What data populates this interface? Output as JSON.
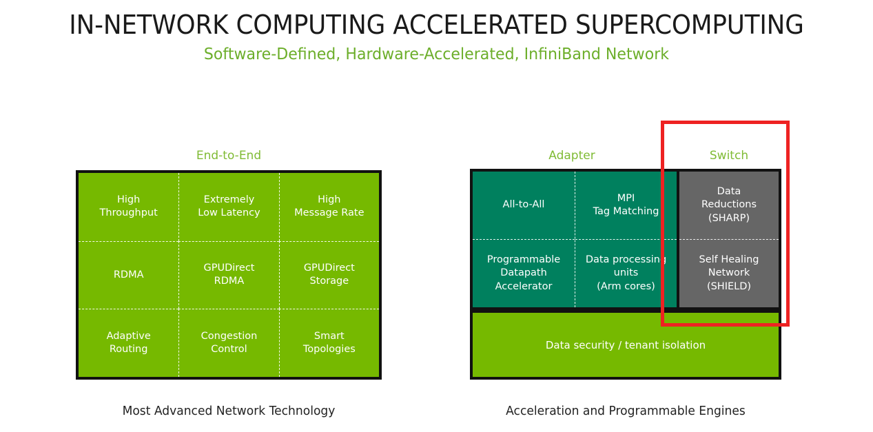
{
  "slide": {
    "title": "IN-NETWORK COMPUTING ACCELERATED SUPERCOMPUTING",
    "subtitle": "Software-Defined, Hardware-Accelerated, InfiniBand Network",
    "accent_green": "#76b900",
    "accent_teal": "#00805e",
    "accent_gray": "#666666",
    "subtitle_green": "#6cae2a",
    "label_green": "#7fbb34",
    "highlight_red": "#ee2222"
  },
  "left_panel": {
    "header": "End-to-End",
    "caption": "Most Advanced Network Technology",
    "grid": {
      "rows": [
        [
          "High\nThroughput",
          "Extremely\nLow Latency",
          "High\nMessage Rate"
        ],
        [
          "RDMA",
          "GPUDirect\nRDMA",
          "GPUDirect\nStorage"
        ],
        [
          "Adaptive\nRouting",
          "Congestion\nControl",
          "Smart\nTopologies"
        ]
      ],
      "cells": [
        {
          "line1": "High",
          "line2": "Throughput"
        },
        {
          "line1": "Extremely",
          "line2": "Low Latency"
        },
        {
          "line1": "High",
          "line2": "Message Rate"
        },
        {
          "line1": "RDMA",
          "line2": ""
        },
        {
          "line1": "GPUDirect",
          "line2": "RDMA"
        },
        {
          "line1": "GPUDirect",
          "line2": "Storage"
        },
        {
          "line1": "Adaptive",
          "line2": "Routing"
        },
        {
          "line1": "Congestion",
          "line2": "Control"
        },
        {
          "line1": "Smart",
          "line2": "Topologies"
        }
      ]
    }
  },
  "right_panel": {
    "headers": {
      "adapter": "Adapter",
      "switch": "Switch"
    },
    "caption": "Acceleration and Programmable Engines",
    "adapter_col1": [
      {
        "line1": "All-to-All",
        "line2": "",
        "line3": ""
      },
      {
        "line1": "Programmable",
        "line2": "Datapath",
        "line3": "Accelerator"
      }
    ],
    "adapter_col2": [
      {
        "line1": "MPI",
        "line2": "Tag Matching",
        "line3": ""
      },
      {
        "line1": "Data processing",
        "line2": "units",
        "line3": "(Arm cores)"
      }
    ],
    "switch_col": [
      {
        "line1": "Data",
        "line2": "Reductions",
        "line3": "(SHARP)"
      },
      {
        "line1": "Self Healing",
        "line2": "Network",
        "line3": "(SHIELD)"
      }
    ],
    "footer_bar": "Data security / tenant isolation"
  }
}
